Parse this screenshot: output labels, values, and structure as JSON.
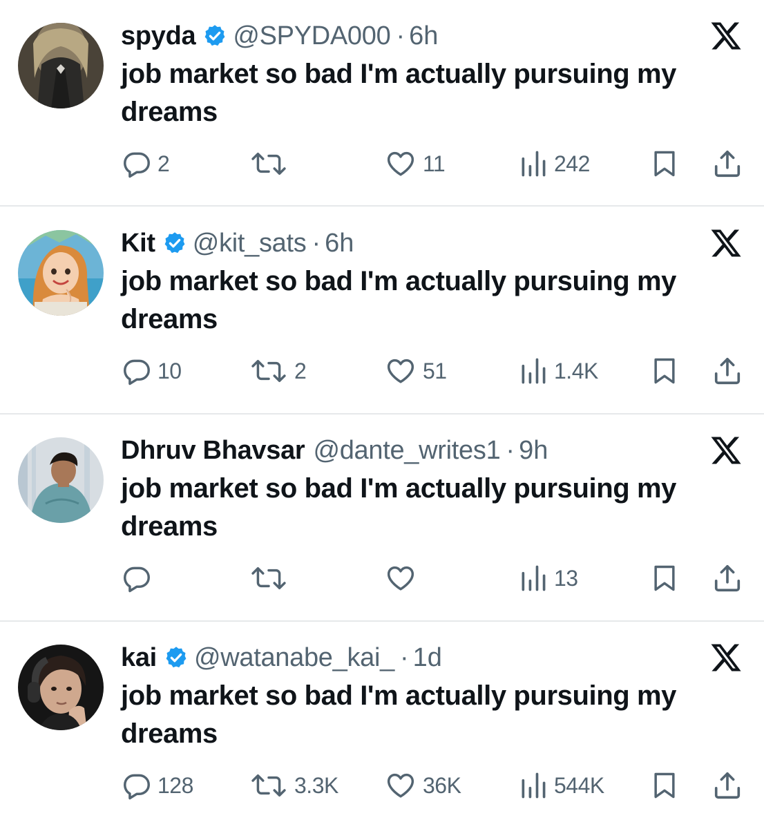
{
  "tweets": [
    {
      "name": "spyda",
      "verified": true,
      "handle": "@SPYDA000",
      "separator": "·",
      "time": "6h",
      "text": "job market so bad I'm actually pursuing my dreams",
      "replies": "2",
      "retweets": "",
      "likes": "11",
      "views": "242",
      "avatar": "dark-figure-avatar"
    },
    {
      "name": "Kit",
      "verified": true,
      "handle": "@kit_sats",
      "separator": "·",
      "time": "6h",
      "text": "job market so bad I'm actually pursuing my dreams",
      "replies": "10",
      "retweets": "2",
      "likes": "51",
      "views": "1.4K",
      "avatar": "cartoon-girl-avatar"
    },
    {
      "name": "Dhruv Bhavsar",
      "verified": false,
      "handle": "@dante_writes1",
      "separator": "·",
      "time": "9h",
      "text": "job market so bad I'm actually pursuing my dreams",
      "replies": "",
      "retweets": "",
      "likes": "",
      "views": "13",
      "avatar": "man-photo-avatar"
    },
    {
      "name": "kai",
      "verified": true,
      "handle": "@watanabe_kai_",
      "separator": "·",
      "time": "1d",
      "text": "job market so bad I'm actually pursuing my dreams",
      "replies": "128",
      "retweets": "3.3K",
      "likes": "36K",
      "views": "544K",
      "avatar": "headphones-guy-avatar"
    }
  ],
  "colors": {
    "text": "#0f1419",
    "secondary": "#536471",
    "verified": "#1d9bf0",
    "divider": "#e6e8ea"
  },
  "icons": [
    "reply-icon",
    "retweet-icon",
    "like-icon",
    "views-icon",
    "bookmark-icon",
    "share-icon",
    "x-logo-icon",
    "verified-badge-icon"
  ]
}
